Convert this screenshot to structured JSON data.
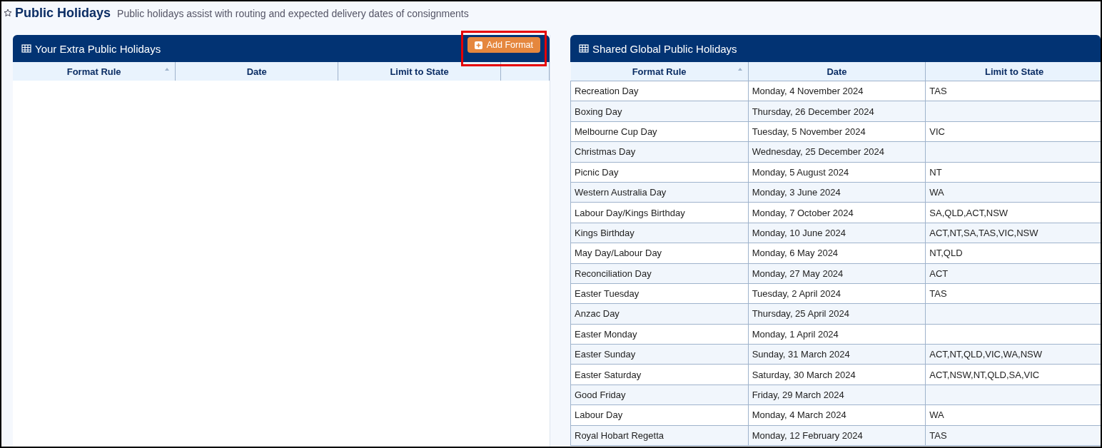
{
  "page": {
    "title": "Public Holidays",
    "subtitle": "Public holidays assist with routing and expected delivery dates of consignments"
  },
  "panels": [
    {
      "title": "Your Extra Public Holidays",
      "button": {
        "label": "Add Format",
        "highlighted": true
      },
      "columns": [
        {
          "label": "Format Rule",
          "sorted": true
        },
        {
          "label": "Date",
          "sorted": false
        },
        {
          "label": "Limit to State",
          "sorted": false
        },
        {
          "sorted": false
        }
      ]
    },
    {
      "title": "Shared Global Public Holidays",
      "columns": [
        {
          "label": "Format Rule",
          "sorted": true
        },
        {
          "label": "Date",
          "sorted": false
        },
        {
          "label": "Limit to State",
          "sorted": false
        }
      ],
      "rows": [
        [
          "Recreation Day",
          "Monday, 4 November 2024",
          "TAS"
        ],
        [
          "Boxing Day",
          "Thursday, 26 December 2024",
          null
        ],
        [
          "Melbourne Cup Day",
          "Tuesday, 5 November 2024",
          "VIC"
        ],
        [
          "Christmas Day",
          "Wednesday, 25 December 2024",
          null
        ],
        [
          "Picnic Day",
          "Monday, 5 August 2024",
          "NT"
        ],
        [
          "Western Australia Day",
          "Monday, 3 June 2024",
          "WA"
        ],
        [
          "Labour Day/Kings Birthday",
          "Monday, 7 October 2024",
          "SA,QLD,ACT,NSW"
        ],
        [
          "Kings Birthday",
          "Monday, 10 June 2024",
          "ACT,NT,SA,TAS,VIC,NSW"
        ],
        [
          "May Day/Labour Day",
          "Monday, 6 May 2024",
          "NT,QLD"
        ],
        [
          "Reconciliation Day",
          "Monday, 27 May 2024",
          "ACT"
        ],
        [
          "Easter Tuesday",
          "Tuesday, 2 April 2024",
          "TAS"
        ],
        [
          "Anzac Day",
          "Thursday, 25 April 2024",
          null
        ],
        [
          "Easter Monday",
          "Monday, 1 April 2024",
          null
        ],
        [
          "Easter Sunday",
          "Sunday, 31 March 2024",
          "ACT,NT,QLD,VIC,WA,NSW"
        ],
        [
          "Easter Saturday",
          "Saturday, 30 March 2024",
          "ACT,NSW,NT,QLD,SA,VIC"
        ],
        [
          "Good Friday",
          "Friday, 29 March 2024",
          null
        ],
        [
          "Labour Day",
          "Monday, 4 March 2024",
          "WA"
        ],
        [
          "Royal Hobart Regetta",
          "Monday, 12 February 2024",
          "TAS"
        ]
      ]
    }
  ]
}
